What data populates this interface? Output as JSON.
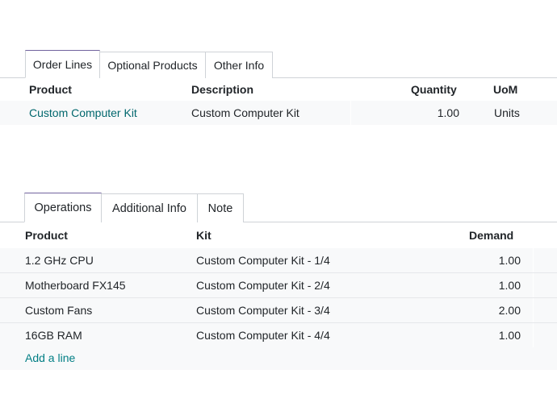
{
  "order_section": {
    "tabs": [
      {
        "label": "Order Lines",
        "active": true
      },
      {
        "label": "Optional Products",
        "active": false
      },
      {
        "label": "Other Info",
        "active": false
      }
    ],
    "columns": {
      "product": "Product",
      "description": "Description",
      "quantity": "Quantity",
      "uom": "UoM"
    },
    "rows": [
      {
        "product": "Custom Computer Kit",
        "description": "Custom Computer Kit",
        "quantity": "1.00",
        "uom": "Units"
      }
    ]
  },
  "operations_section": {
    "tabs": [
      {
        "label": "Operations",
        "active": true
      },
      {
        "label": "Additional Info",
        "active": false
      },
      {
        "label": "Note",
        "active": false
      }
    ],
    "columns": {
      "product": "Product",
      "kit": "Kit",
      "demand": "Demand"
    },
    "rows": [
      {
        "product": "1.2 GHz CPU",
        "kit": "Custom Computer Kit - 1/4",
        "demand": "1.00"
      },
      {
        "product": "Motherboard FX145",
        "kit": "Custom Computer Kit - 2/4",
        "demand": "1.00"
      },
      {
        "product": "Custom Fans",
        "kit": "Custom Computer Kit - 3/4",
        "demand": "2.00"
      },
      {
        "product": "16GB RAM",
        "kit": "Custom Computer Kit - 4/4",
        "demand": "1.00"
      }
    ],
    "add_line": "Add a line"
  },
  "colors": {
    "accent": "#71639e",
    "link": "#017e84",
    "border": "#cfd3d7",
    "row_bg": "#f8f9fa"
  }
}
